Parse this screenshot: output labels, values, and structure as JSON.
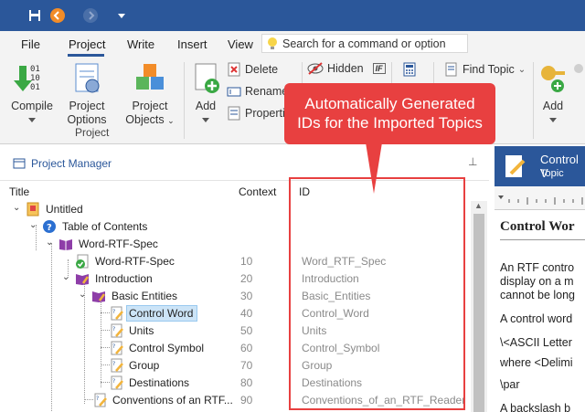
{
  "menu": {
    "tabs": [
      "File",
      "Project",
      "Write",
      "Insert",
      "View"
    ],
    "search_placeholder": "Search for a command or option"
  },
  "ribbon": {
    "compile": "Compile",
    "project_options_1": "Project",
    "project_options_2": "Options",
    "project_objects_1": "Project",
    "project_objects_2": "Objects",
    "group_project": "Project",
    "add": "Add",
    "delete": "Delete",
    "rename": "Rename",
    "properties": "Properties",
    "hidden": "Hidden",
    "hidden_badge": "IF",
    "find_topic": "Find Topic",
    "add2": "Add"
  },
  "pm": {
    "title": "Project Manager",
    "col_title": "Title",
    "col_context": "Context",
    "col_id": "ID"
  },
  "tree": [
    {
      "title": "Untitled",
      "context": "",
      "id": ""
    },
    {
      "title": "Table of Contents",
      "context": "",
      "id": ""
    },
    {
      "title": "Word-RTF-Spec",
      "context": "",
      "id": ""
    },
    {
      "title": "Word-RTF-Spec",
      "context": "10",
      "id": "Word_RTF_Spec"
    },
    {
      "title": "Introduction",
      "context": "20",
      "id": "Introduction"
    },
    {
      "title": "Basic Entities",
      "context": "30",
      "id": "Basic_Entities"
    },
    {
      "title": "Control Word",
      "context": "40",
      "id": "Control_Word"
    },
    {
      "title": "Units",
      "context": "50",
      "id": "Units"
    },
    {
      "title": "Control Symbol",
      "context": "60",
      "id": "Control_Symbol"
    },
    {
      "title": "Group",
      "context": "70",
      "id": "Group"
    },
    {
      "title": "Destinations",
      "context": "80",
      "id": "Destinations"
    },
    {
      "title": "Conventions of an RTF...",
      "context": "90",
      "id": "Conventions_of_an_RTF_Reader"
    }
  ],
  "right_pane": {
    "header_title": "Control V",
    "header_sub": "Topic",
    "doc_heading": "Control Wor",
    "lines": [
      "An RTF contro",
      "display on a m",
      "cannot be long",
      "A control word",
      "\\<ASCII Letter",
      "where <Delimi",
      "\\par",
      "A backslash b"
    ]
  },
  "callout": {
    "line1": "Automatically Generated",
    "line2": "IDs for the Imported Topics"
  },
  "colors": {
    "brand": "#2b579a",
    "callout": "#e84040",
    "selection": "#cce4f7"
  }
}
